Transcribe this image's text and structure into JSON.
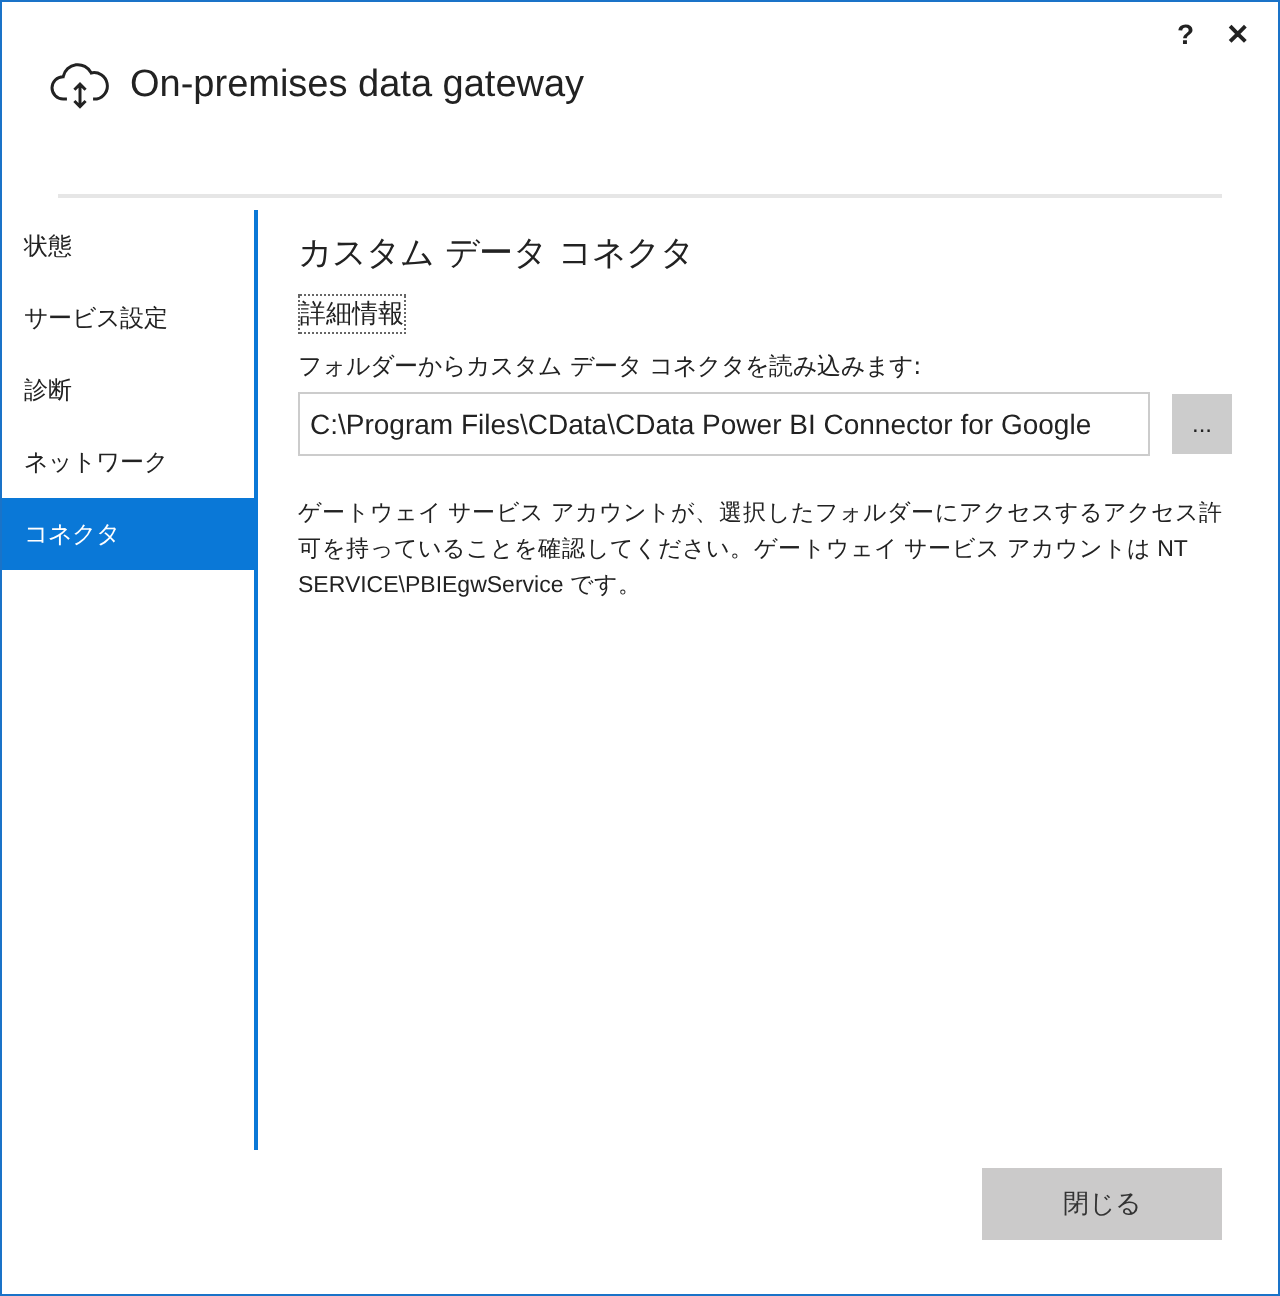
{
  "window": {
    "title": "On-premises data gateway",
    "help": "?",
    "close": "✕"
  },
  "sidebar": {
    "items": [
      {
        "label": "状態",
        "selected": false
      },
      {
        "label": "サービス設定",
        "selected": false
      },
      {
        "label": "診断",
        "selected": false
      },
      {
        "label": "ネットワーク",
        "selected": false
      },
      {
        "label": "コネクタ",
        "selected": true
      }
    ]
  },
  "content": {
    "heading": "カスタム データ コネクタ",
    "link": "詳細情報",
    "folder_label": "フォルダーからカスタム データ コネクタを読み込みます:",
    "folder_path": "C:\\Program Files\\CData\\CData Power BI Connector for Google",
    "browse": "...",
    "note": "ゲートウェイ サービス アカウントが、選択したフォルダーにアクセスするアクセス許可を持っていることを確認してください。ゲートウェイ サービス アカウントは NT SERVICE\\PBIEgwService です。"
  },
  "buttons": [
    {
      "label": "閉じる"
    }
  ]
}
